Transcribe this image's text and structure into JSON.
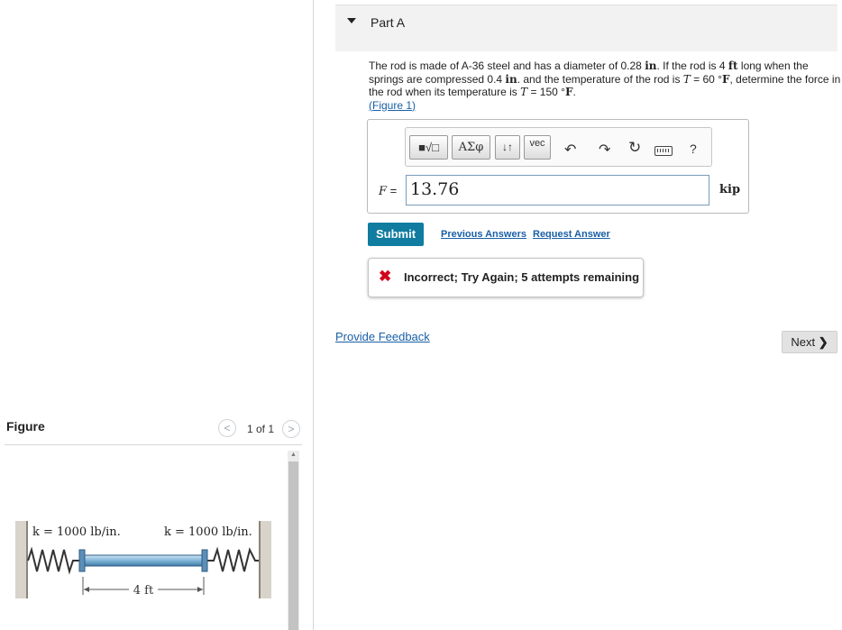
{
  "figure_panel": {
    "title": "Figure",
    "counter": "1 of 1",
    "prev_icon": "chevron-left-icon",
    "next_icon": "chevron-right-icon",
    "figure": {
      "spring_left_label": "k = 1000 lb/in.",
      "spring_right_label": "k = 1000 lb/in.",
      "dimension_label": "4 ft"
    }
  },
  "part": {
    "title": "Part A",
    "question": {
      "t1": "The rod is made of A-36 steel and has a diameter of 0.28 ",
      "u1": "in",
      "t2": ". If the rod is 4 ",
      "u2": "ft",
      "t3": " long when the springs are compressed 0.4 ",
      "u3": "in",
      "t4": ". and the temperature of the rod is ",
      "v1": "T",
      "t5": " = 60 °",
      "u4": "F",
      "t6": ", determine the force in the rod when its temperature is ",
      "v2": "T",
      "t7": " = 150 °",
      "u5": "F",
      "t8": ".",
      "figure_link": "(Figure 1)"
    }
  },
  "toolbar": {
    "templates_label": "■√□",
    "greek_label": "ΑΣφ",
    "arrows_label": "↓↑",
    "vec_label": "vec",
    "undo_icon": "undo-icon",
    "redo_icon": "redo-icon",
    "reset_icon": "reset-icon",
    "keyboard_icon": "keyboard-icon",
    "help_label": "?"
  },
  "answer": {
    "variable": "F",
    "equals": " =",
    "value": "13.76",
    "unit": "kip"
  },
  "actions": {
    "submit": "Submit",
    "previous_answers": "Previous Answers",
    "request_answer": "Request Answer"
  },
  "feedback": {
    "icon": "x-icon",
    "message": "Incorrect; Try Again; 5 attempts remaining"
  },
  "footer": {
    "provide_feedback": "Provide Feedback",
    "next": "Next"
  },
  "colors": {
    "submit_bg": "#0f7ca0",
    "link": "#1a5fa6",
    "error": "#d0021b",
    "rod": "#7fb4d8"
  }
}
